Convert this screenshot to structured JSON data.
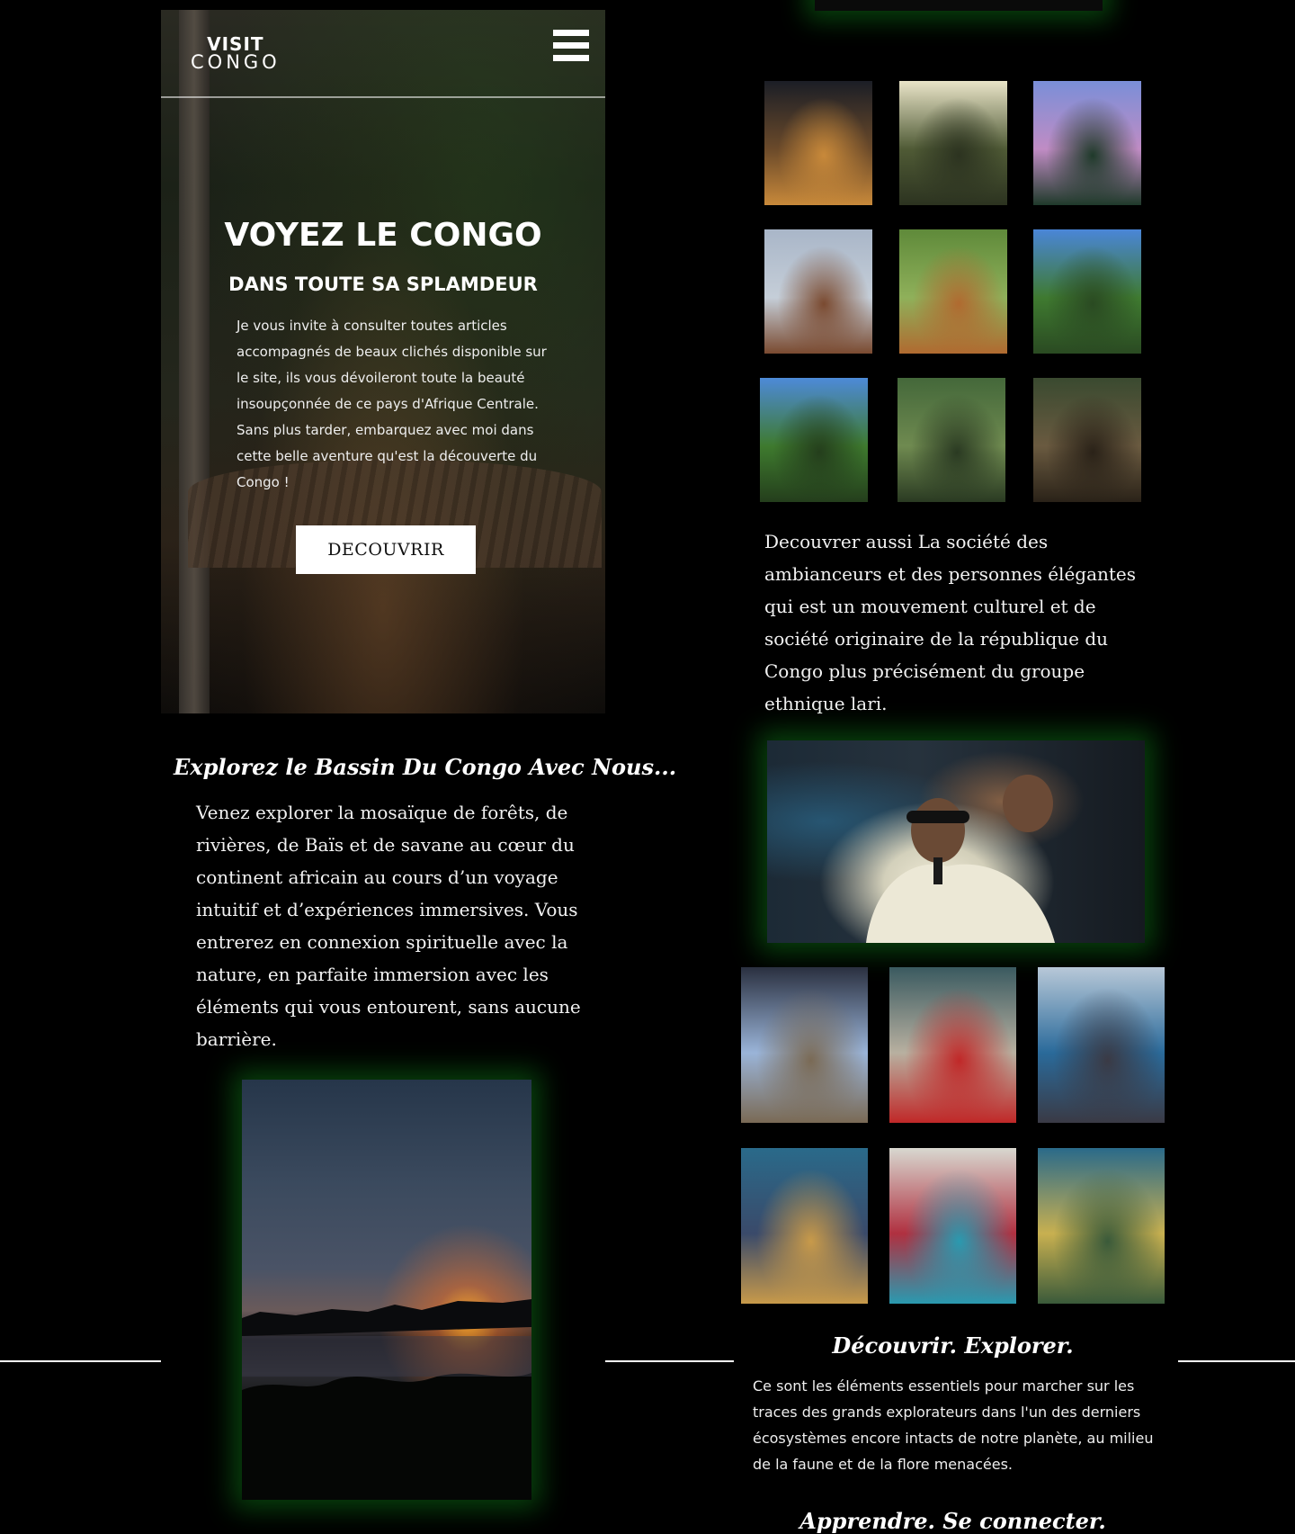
{
  "header": {
    "logo_line1": "VISIT",
    "logo_line2": "CONGO",
    "menu_icon": "hamburger-menu-icon"
  },
  "hero": {
    "title": "VOYEZ LE CONGO",
    "subtitle": "DANS TOUTE SA SPLAMDEUR",
    "body": "Je vous invite à consulter toutes articles accompagnés de beaux clichés disponible sur le site, ils vous dévoileront toute la beauté insoupçonnée de ce pays d'Afrique Centrale. Sans plus tarder, embarquez avec moi dans cette belle aventure qu'est la découverte du Congo !",
    "cta_label": "DECOUVRIR"
  },
  "explore": {
    "heading": "Explorez le Bassin Du Congo Avec Nous...",
    "body": "Venez explorer la mosaïque de forêts,  de rivières, de Baïs et de savane au cœur du continent africain au cours d’un voyage intuitif et d’expériences immersives. Vous entrerez en connexion spirituelle avec la nature, en parfaite immersion avec les éléments qui vous entourent, sans aucune barrière."
  },
  "nature_gallery": [
    {
      "name": "treehouse-night-photo",
      "colors": [
        "#1b1e26",
        "#6b4a2a",
        "#c8893a"
      ]
    },
    {
      "name": "forest-hikers-photo",
      "colors": [
        "#e9e4c8",
        "#4f5a35",
        "#2c3320"
      ]
    },
    {
      "name": "tree-sunset-sky-photo",
      "colors": [
        "#7a8fd8",
        "#c08cc4",
        "#1f3a2a"
      ]
    },
    {
      "name": "eagle-on-rock-photo",
      "colors": [
        "#a9b6c8",
        "#c5ced8",
        "#7a4a30"
      ]
    },
    {
      "name": "antelopes-field-photo",
      "colors": [
        "#5f8a3a",
        "#8fb05a",
        "#b06a30"
      ]
    },
    {
      "name": "river-forest-photo-1",
      "colors": [
        "#4a86d8",
        "#3f7a30",
        "#2a4a22"
      ]
    },
    {
      "name": "river-forest-photo-2",
      "colors": [
        "#4d8ad8",
        "#3e7a2e",
        "#243e1c"
      ]
    },
    {
      "name": "mossy-tree-hiker-photo",
      "colors": [
        "#44683a",
        "#6f8a50",
        "#2a3a22"
      ]
    },
    {
      "name": "wooden-walkway-photo",
      "colors": [
        "#3a4a30",
        "#6a5a40",
        "#2a2218"
      ]
    }
  ],
  "sape": {
    "text": "Decouvrer aussi La société des ambianceurs et des personnes élégantes qui est un mouvement culturel et de société originaire de la république du Congo plus précisément du groupe ethnique lari.",
    "feature_photo": "sapeur-with-pipe-photo"
  },
  "sape_gallery": [
    {
      "name": "sapeur-blue-shirt-photo",
      "colors": [
        "#2a3040",
        "#9ab4d8",
        "#7a6a55"
      ]
    },
    {
      "name": "sapeur-red-tie-photo",
      "colors": [
        "#3a5a60",
        "#b8b0a0",
        "#c02828"
      ]
    },
    {
      "name": "sapeur-dance-street-photo",
      "colors": [
        "#b8c8d8",
        "#2a6a9a",
        "#3a3a45"
      ]
    },
    {
      "name": "sapeur-blue-suit-photo",
      "colors": [
        "#2a6a8a",
        "#3a4a6a",
        "#c89a4a"
      ]
    },
    {
      "name": "crowd-watching-photo",
      "colors": [
        "#d8d8d0",
        "#b03040",
        "#2a9ab0"
      ]
    },
    {
      "name": "sapeur-plaid-suit-photo",
      "colors": [
        "#2a6a8a",
        "#c8b050",
        "#3a5a3a"
      ]
    }
  ],
  "discover_explore": {
    "heading": "Découvrir. Explorer.",
    "body": "Ce sont les éléments essentiels pour marcher sur les traces des grands explorateurs dans l'un des derniers écosystèmes encore intacts de notre planète, au milieu de la faune et de la flore menacées."
  },
  "learn_connect": {
    "heading": "Apprendre. Se connecter."
  }
}
